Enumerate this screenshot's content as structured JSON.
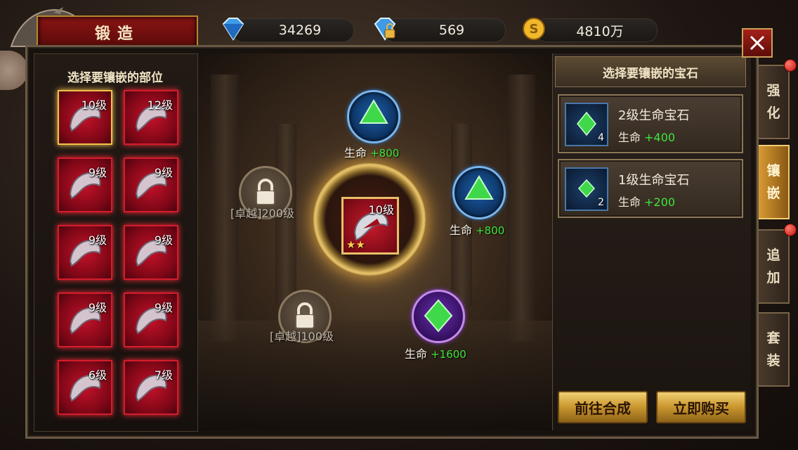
{
  "header": {
    "title": "锻造",
    "resources": [
      {
        "icon": "diamond-icon",
        "value": "34269"
      },
      {
        "icon": "bound-diamond-icon",
        "value": "569"
      },
      {
        "icon": "gold-coin-icon",
        "value": "4810万"
      }
    ],
    "close_icon": "close-icon"
  },
  "left_panel": {
    "title": "选择要镶嵌的部位",
    "slots": [
      {
        "icon": "shoulder-armor-icon",
        "level": "10级",
        "selected": true
      },
      {
        "icon": "cape-icon",
        "level": "12级"
      },
      {
        "icon": "chest-armor-icon",
        "level": "9级"
      },
      {
        "icon": "bracer-icon",
        "level": "9级"
      },
      {
        "icon": "leggings-icon",
        "level": "9级"
      },
      {
        "icon": "necklace-icon",
        "level": "9级"
      },
      {
        "icon": "gauntlet-icon",
        "level": "9级"
      },
      {
        "icon": "ring-icon",
        "level": "9级"
      },
      {
        "icon": "boots-icon",
        "level": "6级"
      },
      {
        "icon": "ring-icon",
        "level": "7级"
      }
    ]
  },
  "center": {
    "item": {
      "icon": "shoulder-armor-icon",
      "level": "10级",
      "stars": 2
    },
    "sockets": [
      {
        "type": "gem",
        "color": "blue",
        "stat": "生命",
        "value": "+800"
      },
      {
        "type": "gem",
        "color": "blue",
        "stat": "生命",
        "value": "+800"
      },
      {
        "type": "gem",
        "color": "purple",
        "stat": "生命",
        "value": "+1600"
      },
      {
        "type": "locked",
        "label": "[卓越]200级"
      },
      {
        "type": "locked",
        "label": "[卓越]100级"
      }
    ]
  },
  "right_panel": {
    "title": "选择要镶嵌的宝石",
    "gems": [
      {
        "name": "2级生命宝石",
        "stat": "生命",
        "value": "+400",
        "count": "4"
      },
      {
        "name": "1级生命宝石",
        "stat": "生命",
        "value": "+200",
        "count": "2"
      }
    ],
    "buttons": {
      "synthesize": "前往合成",
      "buy": "立即购买"
    }
  },
  "side_tabs": [
    {
      "label": "强化",
      "active": false,
      "notify": true
    },
    {
      "label": "镶嵌",
      "active": true,
      "notify": false
    },
    {
      "label": "追加",
      "active": false,
      "notify": true
    },
    {
      "label": "套装",
      "active": false,
      "notify": false
    }
  ],
  "colors": {
    "stat_bonus": "#3fe43b",
    "accent_gold": "#e8c46a",
    "slot_red": "#c4122a"
  }
}
